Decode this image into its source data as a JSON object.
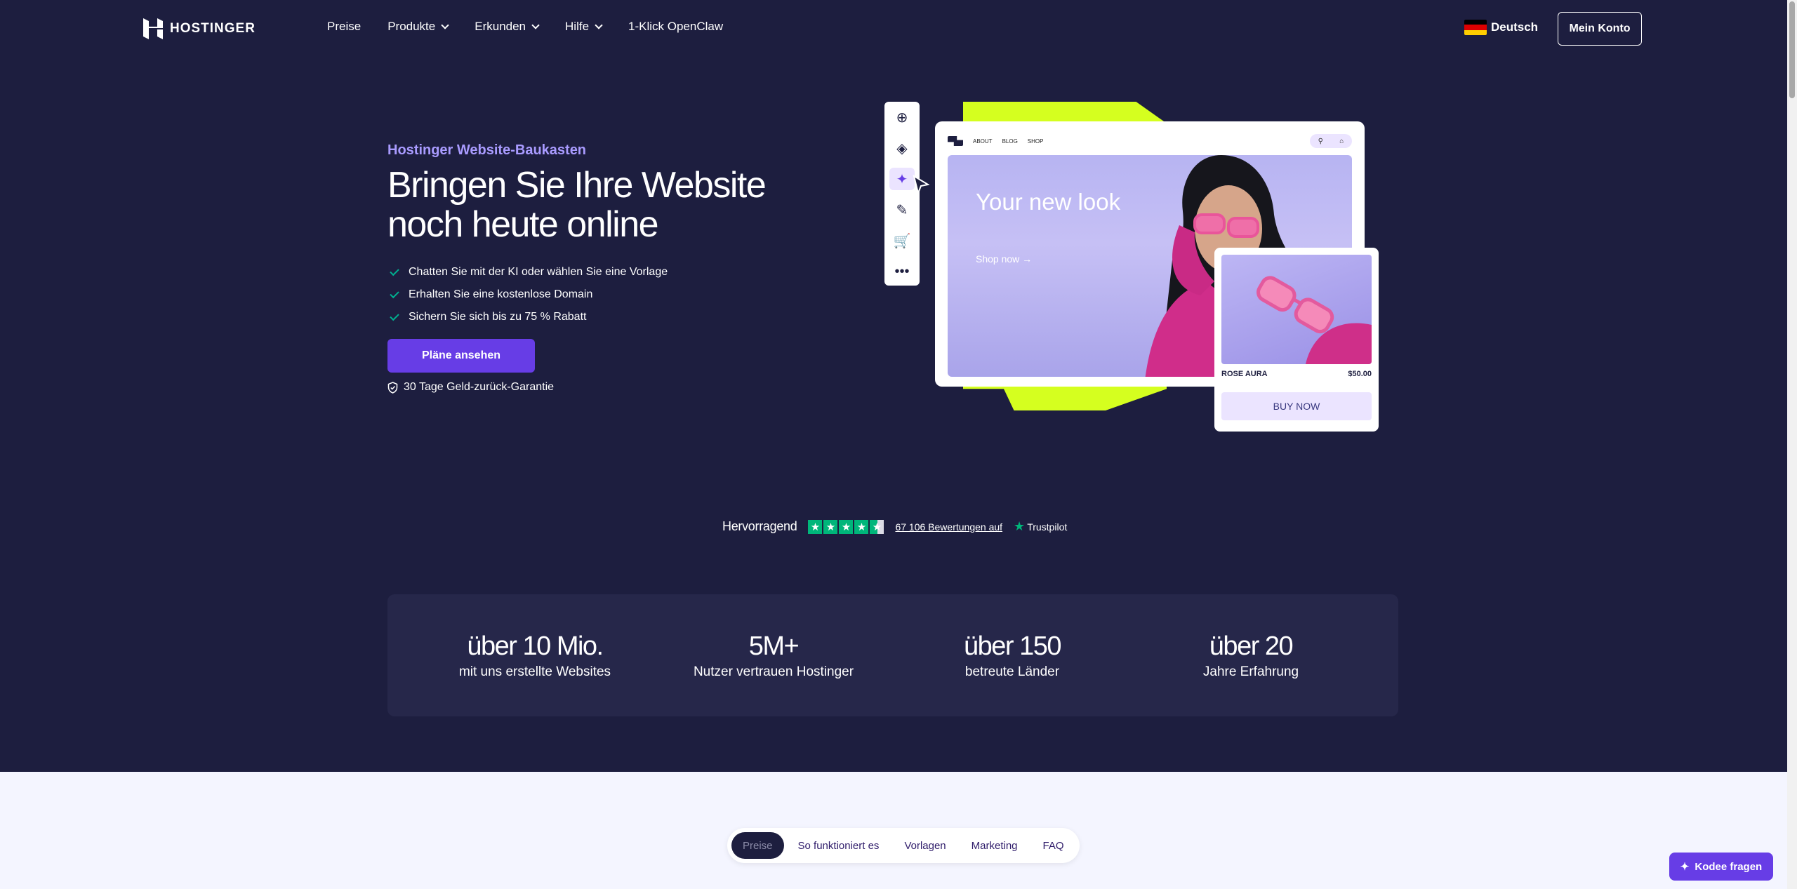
{
  "header": {
    "logo_text": "HOSTINGER",
    "nav": [
      {
        "label": "Preise",
        "dropdown": false
      },
      {
        "label": "Produkte",
        "dropdown": true
      },
      {
        "label": "Erkunden",
        "dropdown": true
      },
      {
        "label": "Hilfe",
        "dropdown": true
      },
      {
        "label": "1-Klick OpenClaw",
        "dropdown": false
      }
    ],
    "language": "Deutsch",
    "account_button": "Mein Konto"
  },
  "hero": {
    "eyebrow": "Hostinger Website-Baukasten",
    "title": "Bringen Sie Ihre Website noch heute online",
    "bullets": [
      "Chatten Sie mit der KI oder wählen Sie eine Vorlage",
      "Erhalten Sie eine kostenlose Domain",
      "Sichern Sie sich bis zu 75 % Rabatt"
    ],
    "cta": "Pläne ansehen",
    "guarantee": "30 Tage Geld-zurück-Garantie"
  },
  "illustration": {
    "nav_links": [
      "ABOUT",
      "BLOG",
      "SHOP"
    ],
    "hero_title": "Your new look",
    "hero_link": "Shop now →",
    "product_name": "ROSE AURA",
    "product_price": "$50.00",
    "buy_button": "BUY NOW"
  },
  "trustpilot": {
    "rating_label": "Hervorragend",
    "reviews": "67 106 Bewertungen auf",
    "brand": "Trustpilot"
  },
  "stats": [
    {
      "value": "über 10 Mio.",
      "label": "mit uns erstellte Websites"
    },
    {
      "value": "5M+",
      "label": "Nutzer vertrauen Hostinger"
    },
    {
      "value": "über 150",
      "label": "betreute Länder"
    },
    {
      "value": "über 20",
      "label": "Jahre Erfahrung"
    }
  ],
  "subnav": {
    "tabs": [
      "Preise",
      "So funktioniert es",
      "Vorlagen",
      "Marketing",
      "FAQ"
    ],
    "active": "Preise"
  },
  "kodee_button": "Kodee fragen",
  "colors": {
    "background": "#1d1e3f",
    "accent": "#673de6",
    "eyebrow": "#a99bff",
    "lime": "#d5ff1f",
    "check": "#00b090",
    "trustpilot": "#00b67a"
  }
}
